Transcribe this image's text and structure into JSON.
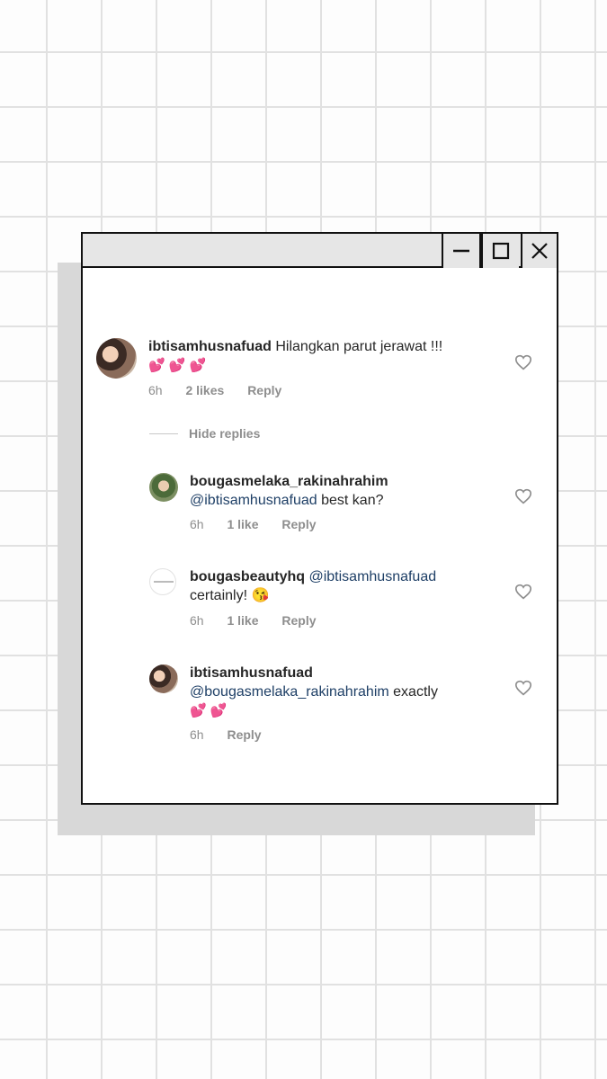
{
  "window": {
    "controls": {
      "minimize_icon": "minimize-icon",
      "maximize_icon": "maximize-icon",
      "close_icon": "close-icon"
    }
  },
  "comments": {
    "main": {
      "username": "ibtisamhusnafuad",
      "text": "Hilangkan parut jerawat !!!",
      "emoji": "💕 💕 💕",
      "time": "6h",
      "likes": "2 likes",
      "reply": "Reply"
    },
    "hide_replies": "Hide replies",
    "replies": [
      {
        "username": "bougasmelaka_rakinahrahim",
        "mention": "@ibtisamhusnafuad",
        "text": " best kan?",
        "time": "6h",
        "likes": "1 like",
        "reply": "Reply"
      },
      {
        "username": "bougasbeautyhq",
        "mention": "@ibtisamhusnafuad",
        "text": "certainly! 😘",
        "time": "6h",
        "likes": "1 like",
        "reply": "Reply"
      },
      {
        "username": "ibtisamhusnafuad",
        "mention": "@bougasmelaka_rakinahrahim",
        "text": " exactly",
        "emoji": "💕 💕",
        "time": "6h",
        "reply": "Reply"
      }
    ]
  },
  "colors": {
    "mention": "#1e3f66",
    "meta": "#8e8e8e",
    "text": "#262626"
  }
}
